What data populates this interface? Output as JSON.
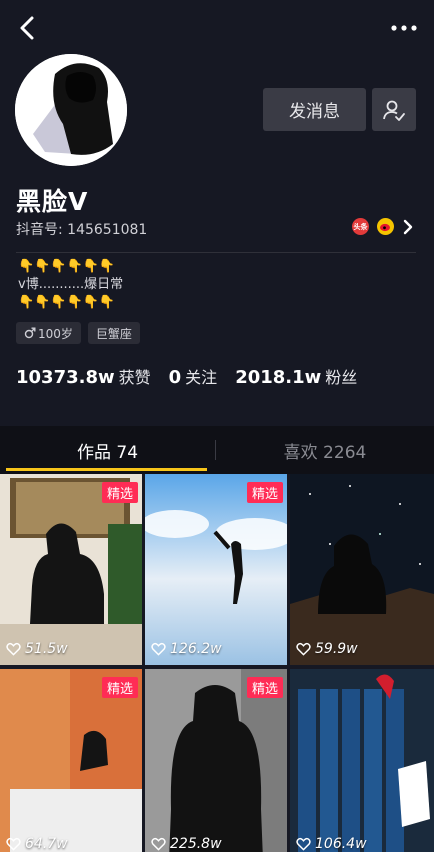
{
  "profile": {
    "name": "黑脸V",
    "douyin_id": "抖音号: 145651081",
    "badge_toutiao": "头条",
    "bio_line1": "👇👇👇👇👇👇",
    "bio_line2": "v博...........爆日常",
    "bio_line3": "👇👇👇👇👇👇"
  },
  "actions": {
    "message_label": "发消息"
  },
  "tags": {
    "age": "100岁",
    "zodiac": "巨蟹座"
  },
  "stats": {
    "likes_num": "10373.8w",
    "likes_label": "获赞",
    "following_num": "0",
    "following_label": "关注",
    "fans_num": "2018.1w",
    "fans_label": "粉丝"
  },
  "tabs": {
    "works": "作品 74",
    "liked": "喜欢 2264"
  },
  "videos": [
    {
      "likes": "51.5w",
      "pick": "精选"
    },
    {
      "likes": "126.2w",
      "pick": "精选"
    },
    {
      "likes": "59.9w"
    },
    {
      "likes": "64.7w",
      "pick": "精选"
    },
    {
      "likes": "225.8w",
      "pick": "精选"
    },
    {
      "likes": "106.4w"
    }
  ],
  "colors": {
    "background": "#161823",
    "accent_tab": "#f7c51a",
    "pick_badge": "#ff2c55"
  }
}
